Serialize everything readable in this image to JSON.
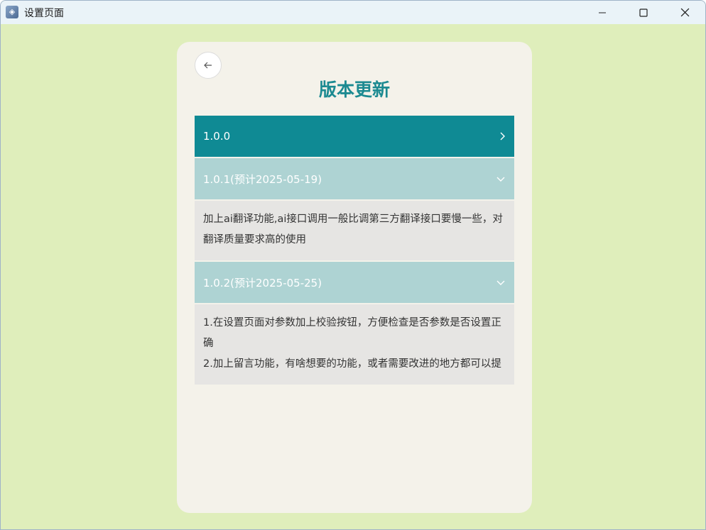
{
  "window": {
    "title": "设置页面"
  },
  "page": {
    "title": "版本更新"
  },
  "versions": [
    {
      "label": "1.0.0",
      "state": "collapsed",
      "notes": []
    },
    {
      "label": "1.0.1(预计2025-05-19)",
      "state": "expanded",
      "notes": [
        "加上ai翻译功能,ai接口调用一般比调第三方翻译接口要慢一些，对翻译质量要求高的使用"
      ]
    },
    {
      "label": "1.0.2(预计2025-05-25)",
      "state": "expanded",
      "notes": [
        "1.在设置页面对参数加上校验按钮，方便检查是否参数是否设置正确",
        "2.加上留言功能，有啥想要的功能，或者需要改进的地方都可以提"
      ]
    }
  ],
  "colors": {
    "background": "#dfeebb",
    "card": "#f4f2ea",
    "accent": "#0f8a94",
    "header_open": "#aed3d3",
    "title": "#1c8a91"
  },
  "icons": {
    "back": "arrow-left-icon",
    "collapsed": "chevron-right-icon",
    "expanded": "chevron-down-icon"
  }
}
